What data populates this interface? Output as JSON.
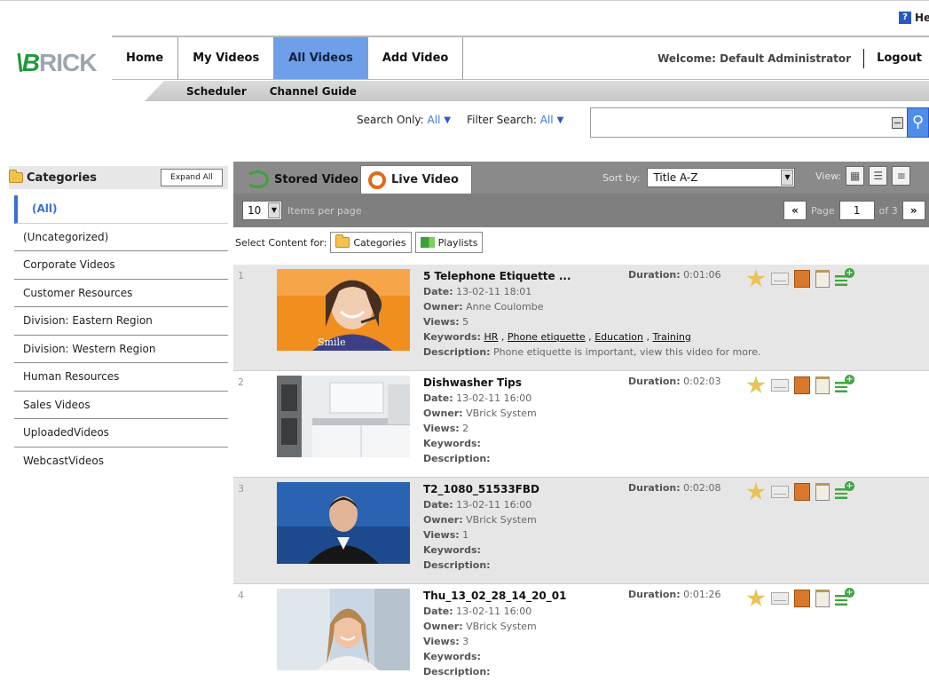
{
  "help": {
    "label": "Help"
  },
  "logo": {
    "text_v": "\\B",
    "text_rest": "RICK"
  },
  "nav": {
    "tabs": [
      {
        "label": "Home"
      },
      {
        "label": "My Videos"
      },
      {
        "label": "All Videos",
        "active": true
      },
      {
        "label": "Add Video"
      }
    ],
    "welcome": "Welcome: Default Administrator",
    "logout": "Logout"
  },
  "subnav": {
    "items": [
      {
        "label": "Scheduler"
      },
      {
        "label": "Channel Guide"
      }
    ]
  },
  "search": {
    "search_only_label": "Search Only:",
    "search_only_value": "All",
    "filter_label": "Filter Search:",
    "filter_value": "All",
    "query": ""
  },
  "sidebar": {
    "title": "Categories",
    "expand_all": "Expand All",
    "items": [
      {
        "label": "(All)",
        "active": true
      },
      {
        "label": "(Uncategorized)"
      },
      {
        "label": "Corporate Videos"
      },
      {
        "label": "Customer Resources"
      },
      {
        "label": "Division: Eastern Region"
      },
      {
        "label": "Division: Western Region"
      },
      {
        "label": "Human Resources"
      },
      {
        "label": "Sales Videos"
      },
      {
        "label": "UploadedVideos"
      },
      {
        "label": "WebcastVideos"
      }
    ]
  },
  "main": {
    "tabs": {
      "stored": "Stored Video",
      "live": "Live Video"
    },
    "sort_label": "Sort by:",
    "sort_value": "Title A-Z",
    "view_label": "View:",
    "items_per_page": "10",
    "items_per_page_label": "Items per page",
    "page_label": "Page",
    "page_value": "1",
    "page_of": "of 3",
    "prev": "«",
    "next": "»",
    "select_content_label": "Select Content for:",
    "categories_btn": "Categories",
    "playlists_btn": "Playlists"
  },
  "labels": {
    "date": "Date:",
    "owner": "Owner:",
    "views": "Views:",
    "keywords": "Keywords:",
    "description": "Description:",
    "duration": "Duration:"
  },
  "videos": [
    {
      "num": "1",
      "title": "5 Telephone Etiquette ...",
      "date": "13-02-11 18:01",
      "owner": "Anne Coulombe",
      "views": "5",
      "keywords": [
        "HR",
        "Phone etiquette",
        "Education",
        "Training"
      ],
      "description": "Phone etiquette is important, view this video for more.",
      "duration": "0:01:06",
      "thumb_caption": "Smile"
    },
    {
      "num": "2",
      "title": "Dishwasher Tips",
      "date": "13-02-11 16:00",
      "owner": "VBrick System",
      "views": "2",
      "keywords": [],
      "description": "",
      "duration": "0:02:03"
    },
    {
      "num": "3",
      "title": "T2_1080_51533FBD",
      "date": "13-02-11 16:00",
      "owner": "VBrick System",
      "views": "1",
      "keywords": [],
      "description": "",
      "duration": "0:02:08"
    },
    {
      "num": "4",
      "title": "Thu_13_02_28_14_20_01",
      "date": "13-02-11 16:00",
      "owner": "VBrick System",
      "views": "3",
      "keywords": [],
      "description": "",
      "duration": "0:01:26"
    }
  ]
}
